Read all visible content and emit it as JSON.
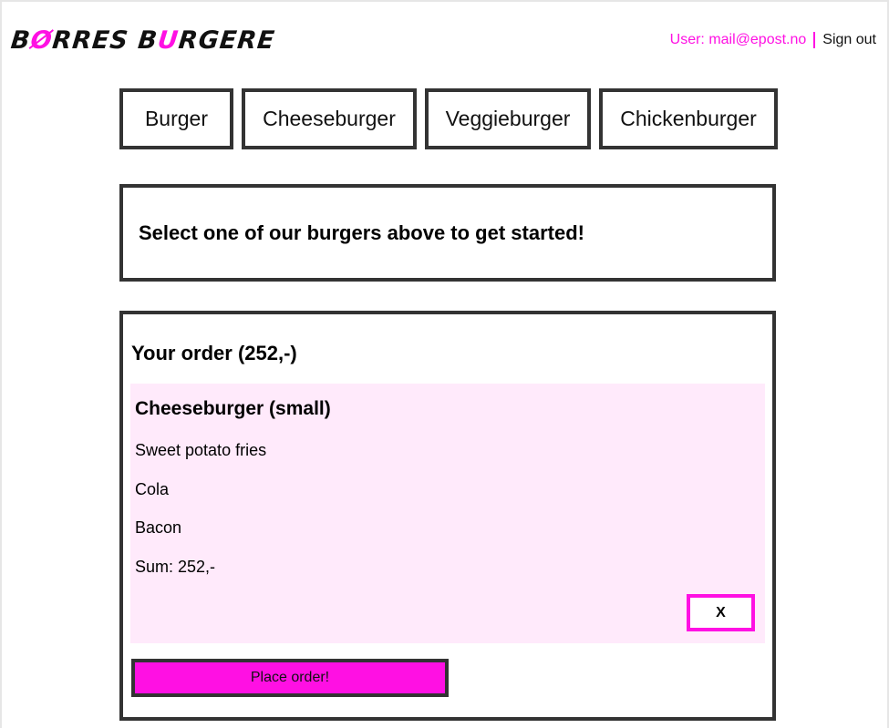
{
  "header": {
    "logo_part1": "B",
    "logo_accent1": "Ø",
    "logo_part2": "RRES B",
    "logo_accent2": "U",
    "logo_part3": "RGERE",
    "user_label": "User: mail@epost.no",
    "signout_label": "Sign out"
  },
  "tabs": [
    {
      "label": "Burger"
    },
    {
      "label": "Cheeseburger"
    },
    {
      "label": "Veggieburger"
    },
    {
      "label": "Chickenburger"
    }
  ],
  "info": {
    "text": "Select one of our burgers above to get started!"
  },
  "order": {
    "title": "Your order (252,-)",
    "items": [
      {
        "title": "Cheeseburger (small)",
        "lines": [
          "Sweet potato fries",
          "Cola",
          "Bacon",
          "Sum: 252,-"
        ],
        "remove_label": "X"
      }
    ],
    "place_order_label": "Place order!"
  },
  "colors": {
    "accent": "#ff10e3",
    "border": "#333333",
    "item_background": "#ffeafb"
  }
}
